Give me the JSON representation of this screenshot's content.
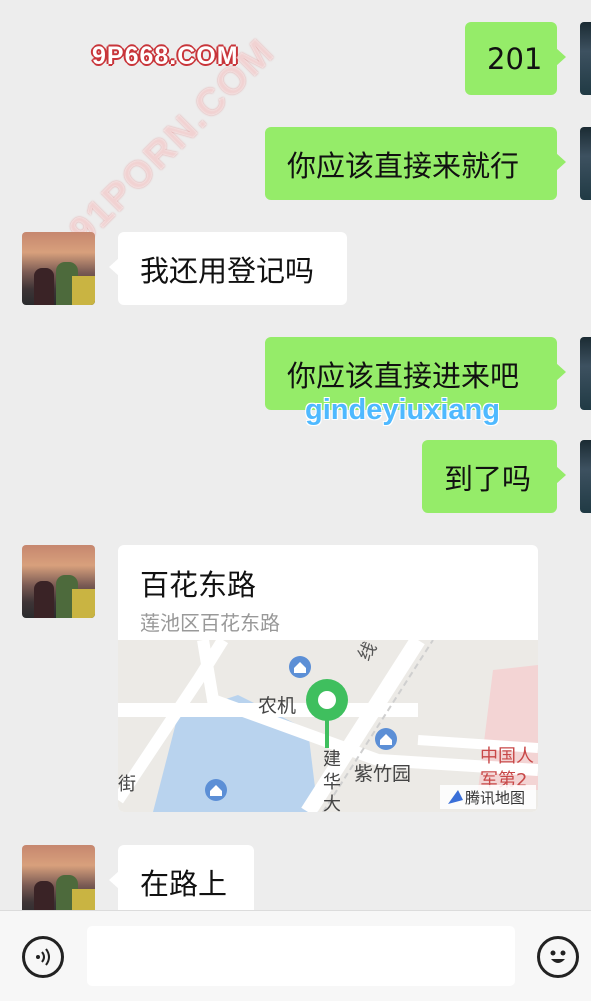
{
  "watermarks": {
    "site": "9P668.COM",
    "diagonal": "91PORN.COM",
    "user": "gindeyiuxiang"
  },
  "messages": [
    {
      "side": "out",
      "text": "201"
    },
    {
      "side": "out",
      "text": "你应该直接来就行"
    },
    {
      "side": "in",
      "text": "我还用登记吗"
    },
    {
      "side": "out",
      "text": "你应该直接进来吧"
    },
    {
      "side": "out",
      "text": "到了吗"
    },
    {
      "side": "in",
      "type": "location",
      "title": "百花东路",
      "address": "莲池区百花东路"
    },
    {
      "side": "in",
      "text": "在路上"
    }
  ],
  "map": {
    "labels": [
      "线",
      "农机",
      "紫竹园",
      "街",
      "建",
      "华",
      "大",
      "中国人",
      "军第2"
    ],
    "provider": "腾讯地图",
    "pin_color": "#3fbf5e"
  },
  "input": {
    "value": ""
  },
  "icons": {
    "voice": "voice-icon",
    "emoji": "emoji-icon"
  },
  "colors": {
    "outgoing": "#95ec69",
    "incoming": "#ffffff",
    "background": "#ededed"
  }
}
